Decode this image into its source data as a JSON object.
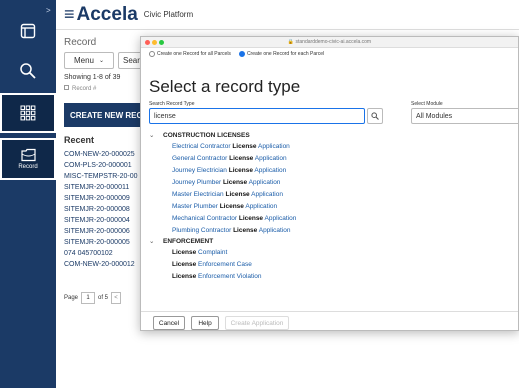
{
  "nav": {
    "record_label": "Record"
  },
  "header": {
    "brand": "Accela",
    "product": "Civic Platform"
  },
  "main": {
    "breadcrumb": "Record",
    "menu_label": "Menu",
    "search_label": "Searc",
    "showing": "Showing 1-8 of 39",
    "record_col": "Record #",
    "create_button": "CREATE NEW RECO",
    "recent_heading": "Recent",
    "recent": [
      "COM-NEW-20-000025",
      "COM-PLS-20-000001",
      "MISC-TEMPSTR-20-00",
      "SITEMJR-20-000011",
      "SITEMJR-20-000009",
      "SITEMJR-20-000008",
      "SITEMJR-20-000004",
      "SITEMJR-20-000006",
      "SITEMJR-20-000005",
      "074 045700102",
      "COM-NEW-20-000012"
    ],
    "pager": {
      "page_label": "Page",
      "page_value": "1",
      "of_label": "of 5"
    }
  },
  "modal": {
    "url": "standarddemo-civic-ai.accela.com",
    "radio_one": "Create one Record for all Parcels",
    "radio_each": "Create one Record for each Parcel",
    "title": "Select a record type",
    "search_label": "Search Record Type",
    "search_value": "license",
    "module_label": "Select Module",
    "module_value": "All Modules",
    "categories": [
      {
        "name": "CONSTRUCTION LICENSES",
        "items": [
          {
            "pre": "Electrical Contractor ",
            "match": "License",
            "post": " Application"
          },
          {
            "pre": "General Contractor ",
            "match": "License",
            "post": " Application"
          },
          {
            "pre": "Journey Electrician ",
            "match": "License",
            "post": " Application"
          },
          {
            "pre": "Journey Plumber ",
            "match": "License",
            "post": " Application"
          },
          {
            "pre": "Master Electrician ",
            "match": "License",
            "post": " Application"
          },
          {
            "pre": "Master Plumber ",
            "match": "License",
            "post": " Application"
          },
          {
            "pre": "Mechanical Contractor ",
            "match": "License",
            "post": " Application"
          },
          {
            "pre": "Plumbing Contractor ",
            "match": "License",
            "post": " Application"
          }
        ]
      },
      {
        "name": "ENFORCEMENT",
        "items": [
          {
            "pre": "",
            "match": "License",
            "post": " Complaint"
          },
          {
            "pre": "",
            "match": "License",
            "post": " Enforcement Case"
          },
          {
            "pre": "",
            "match": "License",
            "post": " Enforcement Violation"
          }
        ]
      }
    ],
    "cancel_label": "Cancel",
    "help_label": "Help",
    "create_label": "Create Application"
  },
  "colors": {
    "nav_bg": "#1b3a66",
    "link": "#1a5ca8",
    "accent": "#1a73e8"
  }
}
